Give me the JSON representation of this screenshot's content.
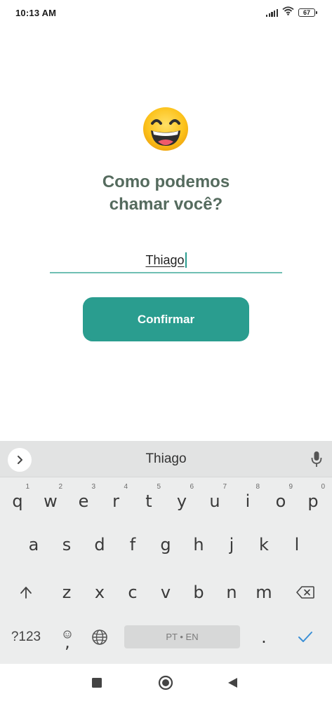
{
  "status_bar": {
    "time": "10:13 AM",
    "battery_level": "67",
    "icons": [
      "signal-icon",
      "wifi-icon",
      "battery-icon"
    ]
  },
  "emoji": "grinning-face-emoji",
  "title": {
    "line1": "Como podemos",
    "line2": "chamar você?"
  },
  "name_input": {
    "value": "Thiago"
  },
  "confirm_button": {
    "label": "Confirmar"
  },
  "colors": {
    "accent": "#2a9d8f",
    "title": "#556b5e",
    "input_underline": "#6fbfb3"
  },
  "keyboard": {
    "suggestion": "Thiago",
    "row1": [
      {
        "key": "q",
        "hint": "1"
      },
      {
        "key": "w",
        "hint": "2"
      },
      {
        "key": "e",
        "hint": "3"
      },
      {
        "key": "r",
        "hint": "4"
      },
      {
        "key": "t",
        "hint": "5"
      },
      {
        "key": "y",
        "hint": "6"
      },
      {
        "key": "u",
        "hint": "7"
      },
      {
        "key": "i",
        "hint": "8"
      },
      {
        "key": "o",
        "hint": "9"
      },
      {
        "key": "p",
        "hint": "0"
      }
    ],
    "row2": [
      "a",
      "s",
      "d",
      "f",
      "g",
      "h",
      "j",
      "k",
      "l"
    ],
    "row3": [
      "z",
      "x",
      "c",
      "v",
      "b",
      "n",
      "m"
    ],
    "symbols_label": "?123",
    "comma": ",",
    "period": ".",
    "space_label": "PT • EN",
    "icons": [
      "expand-icon",
      "mic-icon",
      "shift-icon",
      "backspace-icon",
      "emoji-icon",
      "globe-icon",
      "check-icon"
    ]
  },
  "nav_bar": {
    "icons": [
      "recents-square-icon",
      "home-circle-icon",
      "back-triangle-icon"
    ]
  }
}
